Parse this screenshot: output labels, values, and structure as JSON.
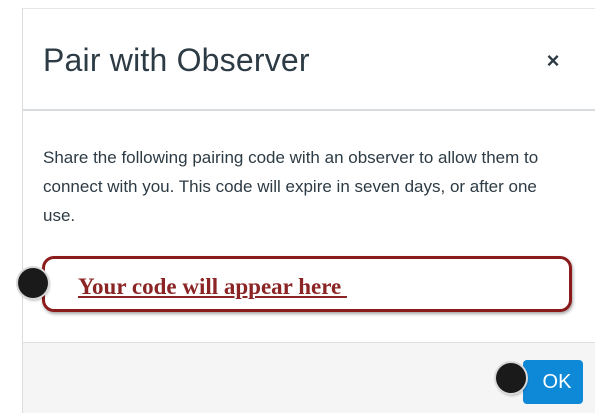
{
  "dialog": {
    "title": "Pair with Observer",
    "close_symbol": "×",
    "description": "Share the following pairing code with an observer to allow them to connect with you. This code will expire in seven days, or after one use.",
    "code_placeholder": "Your code will appear here ",
    "ok_label": "OK"
  },
  "colors": {
    "accent": "#0e89d8",
    "highlight_border": "#8b1a1a",
    "code_text": "#8b2424",
    "text": "#2d3b45"
  },
  "icons": {
    "close": "close-icon",
    "markers": [
      "step-marker-icon",
      "step-marker-icon"
    ]
  }
}
